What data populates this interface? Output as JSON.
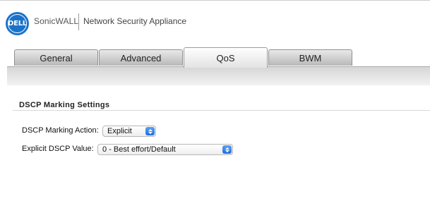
{
  "header": {
    "logo_text": "DELL",
    "brand": "SonicWALL",
    "product": "Network Security Appliance"
  },
  "tabs": [
    {
      "label": "General",
      "active": false
    },
    {
      "label": "Advanced",
      "active": false
    },
    {
      "label": "QoS",
      "active": true
    },
    {
      "label": "BWM",
      "active": false
    }
  ],
  "section": {
    "title": "DSCP Marking Settings"
  },
  "fields": {
    "dscp_action": {
      "label": "DSCP Marking Action:",
      "value": "Explicit"
    },
    "dscp_value": {
      "label": "Explicit DSCP Value:",
      "value": "0 - Best effort/Default"
    }
  },
  "colors": {
    "dell_blue": "#1a73c9",
    "select_arrow": "#1d6fe0"
  }
}
